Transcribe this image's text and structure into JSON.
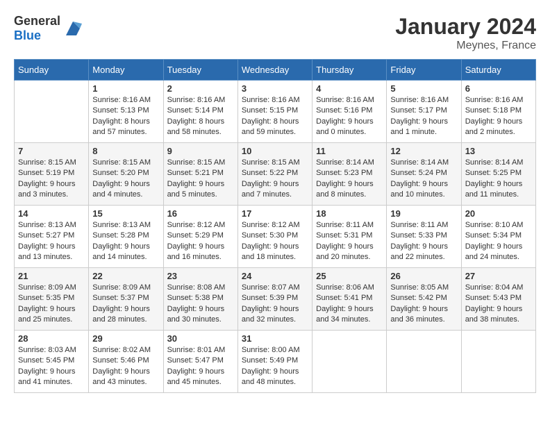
{
  "header": {
    "logo_general": "General",
    "logo_blue": "Blue",
    "month": "January 2024",
    "location": "Meynes, France"
  },
  "weekdays": [
    "Sunday",
    "Monday",
    "Tuesday",
    "Wednesday",
    "Thursday",
    "Friday",
    "Saturday"
  ],
  "weeks": [
    [
      {
        "day": "",
        "sunrise": "",
        "sunset": "",
        "daylight": ""
      },
      {
        "day": "1",
        "sunrise": "Sunrise: 8:16 AM",
        "sunset": "Sunset: 5:13 PM",
        "daylight": "Daylight: 8 hours and 57 minutes."
      },
      {
        "day": "2",
        "sunrise": "Sunrise: 8:16 AM",
        "sunset": "Sunset: 5:14 PM",
        "daylight": "Daylight: 8 hours and 58 minutes."
      },
      {
        "day": "3",
        "sunrise": "Sunrise: 8:16 AM",
        "sunset": "Sunset: 5:15 PM",
        "daylight": "Daylight: 8 hours and 59 minutes."
      },
      {
        "day": "4",
        "sunrise": "Sunrise: 8:16 AM",
        "sunset": "Sunset: 5:16 PM",
        "daylight": "Daylight: 9 hours and 0 minutes."
      },
      {
        "day": "5",
        "sunrise": "Sunrise: 8:16 AM",
        "sunset": "Sunset: 5:17 PM",
        "daylight": "Daylight: 9 hours and 1 minute."
      },
      {
        "day": "6",
        "sunrise": "Sunrise: 8:16 AM",
        "sunset": "Sunset: 5:18 PM",
        "daylight": "Daylight: 9 hours and 2 minutes."
      }
    ],
    [
      {
        "day": "7",
        "sunrise": "Sunrise: 8:15 AM",
        "sunset": "Sunset: 5:19 PM",
        "daylight": "Daylight: 9 hours and 3 minutes."
      },
      {
        "day": "8",
        "sunrise": "Sunrise: 8:15 AM",
        "sunset": "Sunset: 5:20 PM",
        "daylight": "Daylight: 9 hours and 4 minutes."
      },
      {
        "day": "9",
        "sunrise": "Sunrise: 8:15 AM",
        "sunset": "Sunset: 5:21 PM",
        "daylight": "Daylight: 9 hours and 5 minutes."
      },
      {
        "day": "10",
        "sunrise": "Sunrise: 8:15 AM",
        "sunset": "Sunset: 5:22 PM",
        "daylight": "Daylight: 9 hours and 7 minutes."
      },
      {
        "day": "11",
        "sunrise": "Sunrise: 8:14 AM",
        "sunset": "Sunset: 5:23 PM",
        "daylight": "Daylight: 9 hours and 8 minutes."
      },
      {
        "day": "12",
        "sunrise": "Sunrise: 8:14 AM",
        "sunset": "Sunset: 5:24 PM",
        "daylight": "Daylight: 9 hours and 10 minutes."
      },
      {
        "day": "13",
        "sunrise": "Sunrise: 8:14 AM",
        "sunset": "Sunset: 5:25 PM",
        "daylight": "Daylight: 9 hours and 11 minutes."
      }
    ],
    [
      {
        "day": "14",
        "sunrise": "Sunrise: 8:13 AM",
        "sunset": "Sunset: 5:27 PM",
        "daylight": "Daylight: 9 hours and 13 minutes."
      },
      {
        "day": "15",
        "sunrise": "Sunrise: 8:13 AM",
        "sunset": "Sunset: 5:28 PM",
        "daylight": "Daylight: 9 hours and 14 minutes."
      },
      {
        "day": "16",
        "sunrise": "Sunrise: 8:12 AM",
        "sunset": "Sunset: 5:29 PM",
        "daylight": "Daylight: 9 hours and 16 minutes."
      },
      {
        "day": "17",
        "sunrise": "Sunrise: 8:12 AM",
        "sunset": "Sunset: 5:30 PM",
        "daylight": "Daylight: 9 hours and 18 minutes."
      },
      {
        "day": "18",
        "sunrise": "Sunrise: 8:11 AM",
        "sunset": "Sunset: 5:31 PM",
        "daylight": "Daylight: 9 hours and 20 minutes."
      },
      {
        "day": "19",
        "sunrise": "Sunrise: 8:11 AM",
        "sunset": "Sunset: 5:33 PM",
        "daylight": "Daylight: 9 hours and 22 minutes."
      },
      {
        "day": "20",
        "sunrise": "Sunrise: 8:10 AM",
        "sunset": "Sunset: 5:34 PM",
        "daylight": "Daylight: 9 hours and 24 minutes."
      }
    ],
    [
      {
        "day": "21",
        "sunrise": "Sunrise: 8:09 AM",
        "sunset": "Sunset: 5:35 PM",
        "daylight": "Daylight: 9 hours and 25 minutes."
      },
      {
        "day": "22",
        "sunrise": "Sunrise: 8:09 AM",
        "sunset": "Sunset: 5:37 PM",
        "daylight": "Daylight: 9 hours and 28 minutes."
      },
      {
        "day": "23",
        "sunrise": "Sunrise: 8:08 AM",
        "sunset": "Sunset: 5:38 PM",
        "daylight": "Daylight: 9 hours and 30 minutes."
      },
      {
        "day": "24",
        "sunrise": "Sunrise: 8:07 AM",
        "sunset": "Sunset: 5:39 PM",
        "daylight": "Daylight: 9 hours and 32 minutes."
      },
      {
        "day": "25",
        "sunrise": "Sunrise: 8:06 AM",
        "sunset": "Sunset: 5:41 PM",
        "daylight": "Daylight: 9 hours and 34 minutes."
      },
      {
        "day": "26",
        "sunrise": "Sunrise: 8:05 AM",
        "sunset": "Sunset: 5:42 PM",
        "daylight": "Daylight: 9 hours and 36 minutes."
      },
      {
        "day": "27",
        "sunrise": "Sunrise: 8:04 AM",
        "sunset": "Sunset: 5:43 PM",
        "daylight": "Daylight: 9 hours and 38 minutes."
      }
    ],
    [
      {
        "day": "28",
        "sunrise": "Sunrise: 8:03 AM",
        "sunset": "Sunset: 5:45 PM",
        "daylight": "Daylight: 9 hours and 41 minutes."
      },
      {
        "day": "29",
        "sunrise": "Sunrise: 8:02 AM",
        "sunset": "Sunset: 5:46 PM",
        "daylight": "Daylight: 9 hours and 43 minutes."
      },
      {
        "day": "30",
        "sunrise": "Sunrise: 8:01 AM",
        "sunset": "Sunset: 5:47 PM",
        "daylight": "Daylight: 9 hours and 45 minutes."
      },
      {
        "day": "31",
        "sunrise": "Sunrise: 8:00 AM",
        "sunset": "Sunset: 5:49 PM",
        "daylight": "Daylight: 9 hours and 48 minutes."
      },
      {
        "day": "",
        "sunrise": "",
        "sunset": "",
        "daylight": ""
      },
      {
        "day": "",
        "sunrise": "",
        "sunset": "",
        "daylight": ""
      },
      {
        "day": "",
        "sunrise": "",
        "sunset": "",
        "daylight": ""
      }
    ]
  ]
}
